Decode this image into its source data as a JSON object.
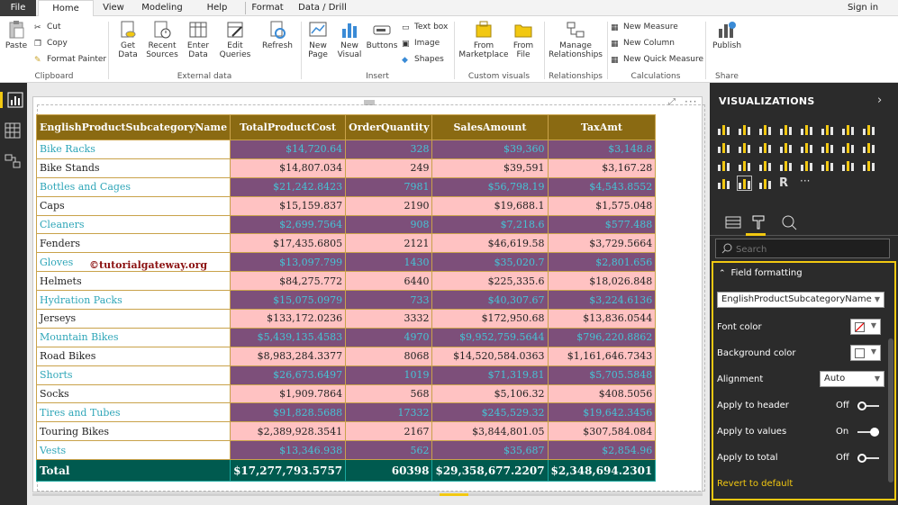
{
  "menu": {
    "tabs": [
      "File",
      "Home",
      "View",
      "Modeling",
      "Help",
      "Format",
      "Data / Drill"
    ],
    "sign_in": "Sign in"
  },
  "ribbon": {
    "clipboard": {
      "paste": "Paste",
      "cut": "Cut",
      "copy": "Copy",
      "format_painter": "Format Painter",
      "group": "Clipboard"
    },
    "external": {
      "get_data": "Get Data",
      "recent_sources": "Recent Sources",
      "enter_data": "Enter Data",
      "edit_queries": "Edit Queries",
      "refresh": "Refresh",
      "group": "External data"
    },
    "insert": {
      "new_page": "New Page",
      "new_visual": "New Visual",
      "buttons": "Buttons",
      "text_box": "Text box",
      "image": "Image",
      "shapes": "Shapes",
      "group": "Insert"
    },
    "custom_visuals": {
      "from_marketplace": "From Marketplace",
      "from_file": "From File",
      "group": "Custom visuals"
    },
    "relationships": {
      "manage": "Manage Relationships",
      "group": "Relationships"
    },
    "calculations": {
      "new_measure": "New Measure",
      "new_column": "New Column",
      "new_quick_measure": "New Quick Measure",
      "group": "Calculations"
    },
    "share": {
      "publish": "Publish",
      "group": "Share"
    }
  },
  "table": {
    "headers": [
      "EnglishProductSubcategoryName",
      "TotalProductCost",
      "OrderQuantity",
      "SalesAmount",
      "TaxAmt"
    ],
    "rows": [
      [
        "Bike Racks",
        "$14,720.64",
        "328",
        "$39,360",
        "$3,148.8"
      ],
      [
        "Bike Stands",
        "$14,807.034",
        "249",
        "$39,591",
        "$3,167.28"
      ],
      [
        "Bottles and Cages",
        "$21,242.8423",
        "7981",
        "$56,798.19",
        "$4,543.8552"
      ],
      [
        "Caps",
        "$15,159.837",
        "2190",
        "$19,688.1",
        "$1,575.048"
      ],
      [
        "Cleaners",
        "$2,699.7564",
        "908",
        "$7,218.6",
        "$577.488"
      ],
      [
        "Fenders",
        "$17,435.6805",
        "2121",
        "$46,619.58",
        "$3,729.5664"
      ],
      [
        "Gloves",
        "$13,097.799",
        "1430",
        "$35,020.7",
        "$2,801.656"
      ],
      [
        "Helmets",
        "$84,275.772",
        "6440",
        "$225,335.6",
        "$18,026.848"
      ],
      [
        "Hydration Packs",
        "$15,075.0979",
        "733",
        "$40,307.67",
        "$3,224.6136"
      ],
      [
        "Jerseys",
        "$133,172.0236",
        "3332",
        "$172,950.68",
        "$13,836.0544"
      ],
      [
        "Mountain Bikes",
        "$5,439,135.4583",
        "4970",
        "$9,952,759.5644",
        "$796,220.8862"
      ],
      [
        "Road Bikes",
        "$8,983,284.3377",
        "8068",
        "$14,520,584.0363",
        "$1,161,646.7343"
      ],
      [
        "Shorts",
        "$26,673.6497",
        "1019",
        "$71,319.81",
        "$5,705.5848"
      ],
      [
        "Socks",
        "$1,909.7864",
        "568",
        "$5,106.32",
        "$408.5056"
      ],
      [
        "Tires and Tubes",
        "$91,828.5688",
        "17332",
        "$245,529.32",
        "$19,642.3456"
      ],
      [
        "Touring Bikes",
        "$2,389,928.3541",
        "2167",
        "$3,844,801.05",
        "$307,584.084"
      ],
      [
        "Vests",
        "$13,346.938",
        "562",
        "$35,687",
        "$2,854.96"
      ]
    ],
    "total": [
      "Total",
      "$17,277,793.5757",
      "60398",
      "$29,358,677.2207",
      "$2,348,694.2301"
    ]
  },
  "watermark": "©tutorialgateway.org",
  "visualizations": {
    "title": "VISUALIZATIONS",
    "search_placeholder": "Search",
    "field_formatting": {
      "header": "Field formatting",
      "field": "EnglishProductSubcategoryName",
      "font_color": "Font color",
      "background_color": "Background color",
      "alignment": "Alignment",
      "alignment_value": "Auto",
      "apply_header": "Apply to header",
      "apply_header_state": "Off",
      "apply_values": "Apply to values",
      "apply_values_state": "On",
      "apply_total": "Apply to total",
      "apply_total_state": "Off",
      "revert": "Revert to default"
    }
  },
  "colors": {
    "accent": "#f2c811",
    "header_bg": "#8a6a12",
    "total_bg": "#005a4f",
    "odd_value_bg": "#7d4f7a",
    "even_value_bg": "#ffc2c2",
    "odd_text": "#2fa6b8"
  }
}
